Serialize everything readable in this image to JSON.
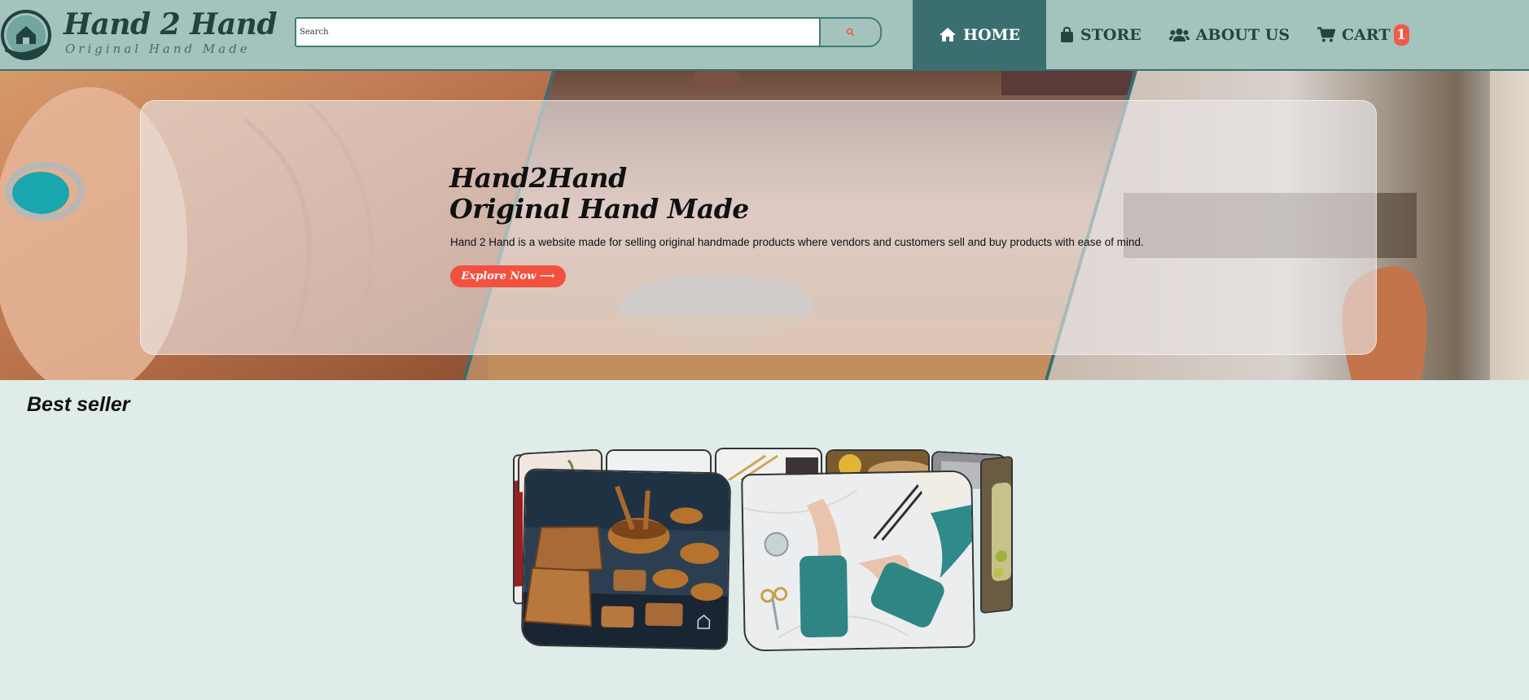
{
  "brand": {
    "title": "Hand 2 Hand",
    "tagline": "Original Hand Made"
  },
  "search": {
    "placeholder": "Search"
  },
  "nav": {
    "items": [
      {
        "label": "HOME",
        "icon": "home-icon",
        "active": true
      },
      {
        "label": "STORE",
        "icon": "shopping-bag-icon",
        "active": false
      },
      {
        "label": "ABOUT US",
        "icon": "users-icon",
        "active": false
      },
      {
        "label": "CART",
        "icon": "cart-icon",
        "active": false
      }
    ],
    "cart_count": "1"
  },
  "hero": {
    "title_line1": "Hand2Hand",
    "title_line2": "Original Hand Made",
    "description": "Hand 2 Hand is a website made for selling original handmade products where vendors and customers sell and buy products with ease of mind.",
    "button_label": "Explore Now ⟶"
  },
  "best_seller": {
    "title": "Best seller",
    "products": [
      {
        "name": "wooden-bowls-image"
      },
      {
        "name": "knitted-gloves-image"
      },
      {
        "name": "knitting-needles-image"
      },
      {
        "name": "sunflower-hat-image"
      },
      {
        "name": "wood-carving-image"
      },
      {
        "name": "pottery-image"
      },
      {
        "name": "red-craft-image"
      },
      {
        "name": "olive-jar-image"
      }
    ]
  },
  "colors": {
    "header_bg": "#a4c3bc",
    "nav_active_bg": "#3a6e70",
    "accent": "#f2513f",
    "page_bg": "#dfecea",
    "brand_text": "#21433f"
  }
}
